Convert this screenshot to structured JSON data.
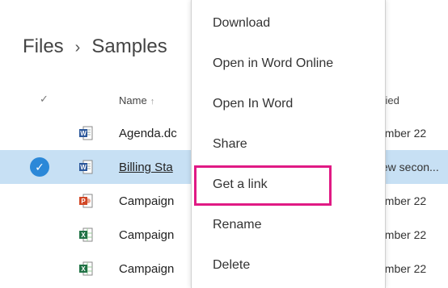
{
  "breadcrumb": {
    "root": "Files",
    "separator": "›",
    "current": "Samples"
  },
  "table": {
    "check_header": "✓",
    "name_header": "Name",
    "sort_arrow": "↑",
    "modified_header": "ified",
    "rows": [
      {
        "name": "Agenda.dc",
        "modified": "ember 22",
        "type": "word",
        "selected": false
      },
      {
        "name": "Billing Sta",
        "modified": "few secon...",
        "type": "word",
        "selected": true
      },
      {
        "name": "Campaign",
        "modified": "ember 22",
        "type": "powerpoint",
        "selected": false
      },
      {
        "name": "Campaign",
        "modified": "ember 22",
        "type": "excel",
        "selected": false
      },
      {
        "name": "Campaign",
        "modified": "ember 22",
        "type": "excel",
        "selected": false
      }
    ]
  },
  "context_menu": {
    "items": [
      "Download",
      "Open in Word Online",
      "Open In Word",
      "Share",
      "Get a link",
      "Rename",
      "Delete"
    ],
    "highlighted": "Get a link"
  },
  "colors": {
    "selected_row": "#c7e0f4",
    "check_circle": "#2b88d8",
    "highlight_border": "#e01a84",
    "word": "#2b579a",
    "powerpoint": "#d24726",
    "excel": "#217346"
  }
}
